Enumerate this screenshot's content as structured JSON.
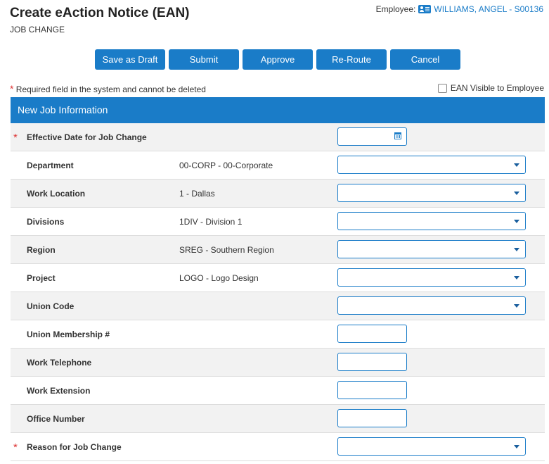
{
  "header": {
    "title": "Create eAction Notice (EAN)",
    "subtitle": "JOB CHANGE",
    "employee_label": "Employee:",
    "employee_name": "WILLIAMS, ANGEL - S00136"
  },
  "toolbar": {
    "save_draft": "Save as Draft",
    "submit": "Submit",
    "approve": "Approve",
    "reroute": "Re-Route",
    "cancel": "Cancel"
  },
  "required_note": "Required field in the system and cannot be deleted",
  "visible_to_employee": "EAN Visible to Employee",
  "section_title": "New Job Information",
  "rows": [
    {
      "label": "Effective Date for Job Change",
      "value": "",
      "control": "date",
      "required": true
    },
    {
      "label": "Department",
      "value": "00-CORP - 00-Corporate",
      "control": "select",
      "required": false
    },
    {
      "label": "Work Location",
      "value": "1 - Dallas",
      "control": "select",
      "required": false
    },
    {
      "label": "Divisions",
      "value": "1DIV - Division 1",
      "control": "select",
      "required": false
    },
    {
      "label": "Region",
      "value": "SREG - Southern Region",
      "control": "select",
      "required": false
    },
    {
      "label": "Project",
      "value": "LOGO - Logo Design",
      "control": "select",
      "required": false
    },
    {
      "label": "Union Code",
      "value": "",
      "control": "select",
      "required": false
    },
    {
      "label": "Union Membership #",
      "value": "",
      "control": "text",
      "required": false
    },
    {
      "label": "Work Telephone",
      "value": "",
      "control": "text",
      "required": false
    },
    {
      "label": "Work Extension",
      "value": "",
      "control": "text",
      "required": false
    },
    {
      "label": "Office Number",
      "value": "",
      "control": "text",
      "required": false
    },
    {
      "label": "Reason for Job Change",
      "value": "",
      "control": "select",
      "required": true
    }
  ],
  "colors": {
    "accent": "#1a7cc8",
    "required": "#d33333",
    "row_alt": "#f2f2f2"
  }
}
